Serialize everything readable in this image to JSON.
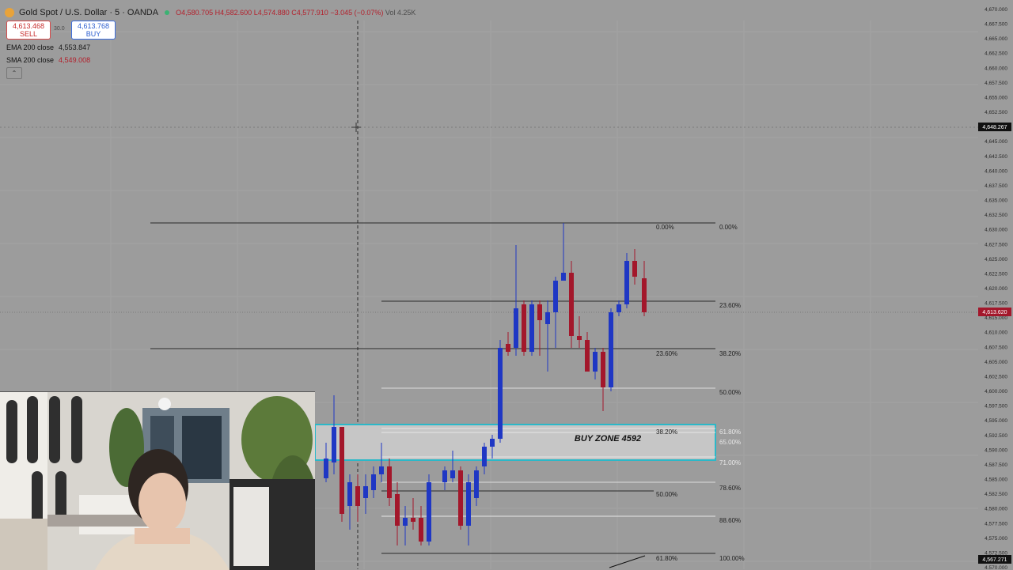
{
  "header": {
    "symbol": "Gold Spot / U.S. Dollar · 5 · OANDA",
    "ohlc": {
      "open": "O4,580.705",
      "high": "H4,582.600",
      "low": "L4,574.880",
      "close": "C4,577.910",
      "change": "−3.045 (−0.07%)",
      "volume": "Vol 4.25K"
    }
  },
  "trade": {
    "sell_price": "4,613.468",
    "sell_label": "SELL",
    "spread": "30.0",
    "buy_price": "4,613.768",
    "buy_label": "BUY"
  },
  "indicators": [
    {
      "label": "EMA 200 close",
      "value": "4,553.847"
    },
    {
      "label": "SMA 200 close",
      "value": "4,549.008"
    }
  ],
  "collapse_icon": "chevron-up-icon",
  "price_axis": {
    "labels": [
      "4,670.000",
      "4,667.500",
      "4,665.000",
      "4,662.500",
      "4,660.000",
      "4,657.500",
      "4,655.000",
      "4,652.500",
      "4,650.000",
      "4,645.000",
      "4,642.500",
      "4,640.000",
      "4,637.500",
      "4,635.000",
      "4,632.500",
      "4,630.000",
      "4,627.500",
      "4,625.000",
      "4,622.500",
      "4,620.000",
      "4,617.500",
      "4,615.000",
      "4,610.000",
      "4,607.500",
      "4,605.000",
      "4,602.500",
      "4,600.000",
      "4,597.500",
      "4,595.000",
      "4,592.500",
      "4,590.000",
      "4,587.500",
      "4,585.000",
      "4,582.500",
      "4,580.000",
      "4,577.500",
      "4,575.000",
      "4,572.500",
      "4,570.000"
    ],
    "crosshair_price": "4,648.267",
    "current_price": "4,613.620",
    "last_price": "4,567.271"
  },
  "fib_left": [
    "0.00%",
    "23.60%",
    "38.20%",
    "50.00%",
    "61.80%"
  ],
  "fib_right": [
    "0.00%",
    "23.60%",
    "38.20%",
    "50.00%",
    "61.80%",
    "65.00%",
    "71.00%",
    "78.60%",
    "88.60%",
    "100.00%"
  ],
  "zone": {
    "label": "BUY ZONE 4592",
    "border_color": "#2bb8c8"
  },
  "colors": {
    "bull": "#1f37c4",
    "bear": "#a3172b",
    "background": "#9c9c9c"
  },
  "webcam": {
    "description": "streamer-webcam"
  }
}
